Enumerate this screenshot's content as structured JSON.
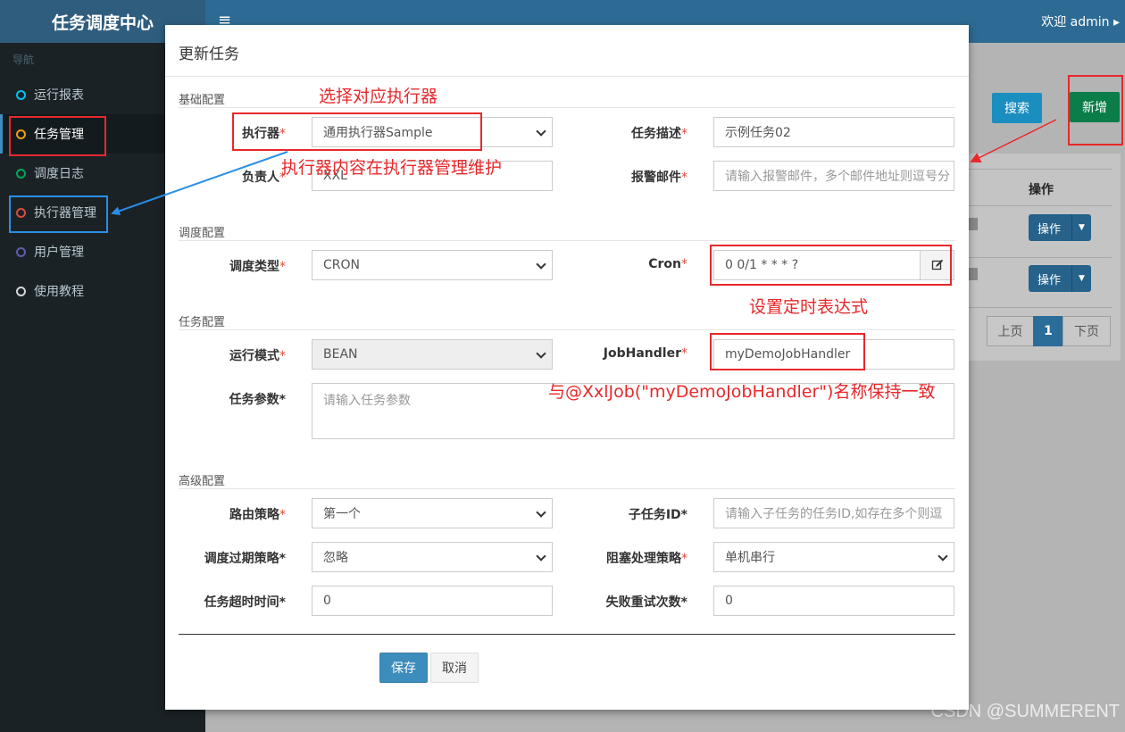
{
  "header": {
    "logo": "任务调度中心",
    "toggle_icon": "≡",
    "welcome": "欢迎 admin ▸"
  },
  "sidebar": {
    "header": "导航",
    "items": [
      {
        "label": "运行报表",
        "color": "#00c0ef"
      },
      {
        "label": "任务管理",
        "color": "#f39c12"
      },
      {
        "label": "调度日志",
        "color": "#00a65a"
      },
      {
        "label": "执行器管理",
        "color": "#dd4b39"
      },
      {
        "label": "用户管理",
        "color": "#605ca8"
      },
      {
        "label": "使用教程",
        "color": "#d2d6de"
      }
    ]
  },
  "background": {
    "search_label": "搜索",
    "add_label": "新增",
    "col_op": "操作",
    "op_label": "操作",
    "prev": "上页",
    "page": "1",
    "next": "下页"
  },
  "modal": {
    "title": "更新任务",
    "sections": {
      "basic": "基础配置",
      "schedule": "调度配置",
      "task": "任务配置",
      "advanced": "高级配置"
    },
    "fields": {
      "executor": {
        "label": "执行器",
        "value": "通用执行器Sample"
      },
      "desc": {
        "label": "任务描述",
        "value": "示例任务02"
      },
      "author": {
        "label": "负责人",
        "value": "XXL"
      },
      "alarm": {
        "label": "报警邮件",
        "placeholder": "请输入报警邮件，多个邮件地址则逗号分"
      },
      "schedule_type": {
        "label": "调度类型",
        "value": "CRON"
      },
      "cron": {
        "label": "Cron",
        "value": "0 0/1 * * * ?"
      },
      "run_mode": {
        "label": "运行模式",
        "value": "BEAN"
      },
      "job_handler": {
        "label": "JobHandler",
        "value": "myDemoJobHandler"
      },
      "params": {
        "label": "任务参数",
        "placeholder": "请输入任务参数"
      },
      "route": {
        "label": "路由策略",
        "value": "第一个"
      },
      "child": {
        "label": "子任务ID",
        "placeholder": "请输入子任务的任务ID,如存在多个则逗"
      },
      "misfire": {
        "label": "调度过期策略",
        "value": "忽略"
      },
      "block": {
        "label": "阻塞处理策略",
        "value": "单机串行"
      },
      "timeout": {
        "label": "任务超时时间",
        "value": "0"
      },
      "retry": {
        "label": "失败重试次数",
        "value": "0"
      }
    },
    "save": "保存",
    "cancel": "取消"
  },
  "annotations": {
    "choose_executor": "选择对应执行器",
    "executor_maintain": "执行器内容在执行器管理维护",
    "set_cron": "设置定时表达式",
    "handler_match": "与@XxlJob(\"myDemoJobHandler\")名称保持一致"
  },
  "watermark": "CSDN @SUMMERENT"
}
